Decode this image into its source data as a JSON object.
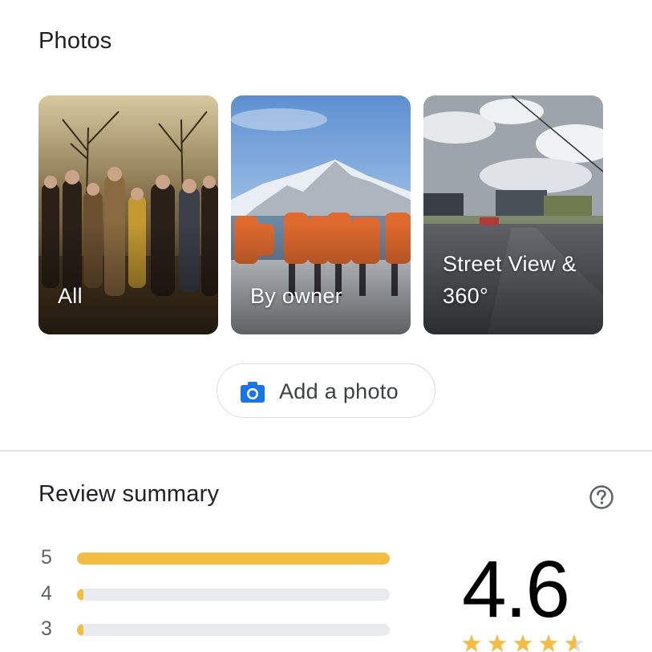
{
  "photos": {
    "title": "Photos",
    "cards": [
      {
        "label": "All"
      },
      {
        "label": "By owner"
      },
      {
        "label": "Street View & 360°"
      }
    ],
    "add_photo_label": "Add a photo"
  },
  "review_summary": {
    "title": "Review summary",
    "rating": "4.6",
    "stars_value": 4.6,
    "bars": [
      {
        "stars": "5",
        "fraction": 1.0
      },
      {
        "stars": "4",
        "fraction": 0.02
      },
      {
        "stars": "3",
        "fraction": 0.02
      }
    ]
  },
  "colors": {
    "bar_fill": "#f2bd42",
    "bar_track": "#e8eaed",
    "star": "#f2bd42",
    "star_empty": "#dadce0",
    "camera_icon": "#1a73e8"
  },
  "icons": {
    "camera": "add-photo-camera-icon",
    "help": "question-mark-circle-icon",
    "star": "star-icon"
  }
}
